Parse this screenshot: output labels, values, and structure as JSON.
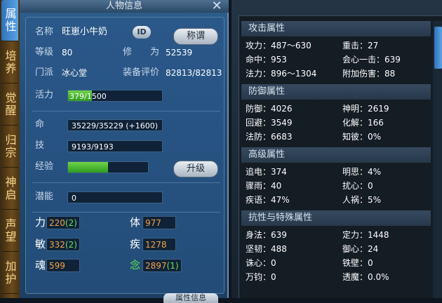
{
  "tabs": [
    "属性",
    "培养",
    "觉醒",
    "归宗",
    "神启",
    "声望",
    "加护"
  ],
  "window": {
    "title": "人物信息",
    "close": "✕"
  },
  "info": {
    "name_label": "名称",
    "name_value": "旺崽小牛奶",
    "id_button": "ID",
    "title_button": "称谓",
    "level_label": "等级",
    "level_value": "80",
    "cultivation_label": "修　　为",
    "cultivation_value": "52539",
    "sect_label": "门派",
    "sect_value": "冰心堂",
    "gear_label": "装备评价",
    "gear_value": "82813/82813",
    "vitality_label": "活力",
    "vitality_value": "379/1500",
    "vitality_fraction": 0.253
  },
  "stats": {
    "life_label": "命",
    "life_value": "35229/35229 (+1600)",
    "skill_label": "技",
    "skill_value": "9193/9193",
    "exp_label": "经验",
    "exp_fraction": 0.5,
    "upgrade_button": "升级",
    "potential_label": "潜能",
    "potential_value": "0"
  },
  "attributes": {
    "str_label": "力",
    "str_value": "220",
    "str_bonus": "(2)",
    "con_label": "体",
    "con_value": "977",
    "agi_label": "敏",
    "agi_value": "332",
    "agi_bonus": "(2)",
    "spd_label": "疾",
    "spd_value": "1278",
    "soul_label": "魂",
    "soul_value": "599",
    "mind_label": "念",
    "mind_value": "2897",
    "mind_bonus": "(1)"
  },
  "bottom_button": "属性信息",
  "right": {
    "attack_header": "攻击属性",
    "attack": [
      {
        "k": "攻力：",
        "v": "487～630"
      },
      {
        "k": "重击：",
        "v": "27"
      },
      {
        "k": "命中：",
        "v": "953"
      },
      {
        "k": "会心一击：",
        "v": "639"
      },
      {
        "k": "法力：",
        "v": "896～1304"
      },
      {
        "k": "附加伤害：",
        "v": "88"
      }
    ],
    "defense_header": "防御属性",
    "defense": [
      {
        "k": "防御：",
        "v": "4026"
      },
      {
        "k": "神明：",
        "v": "2619"
      },
      {
        "k": "回避：",
        "v": "3549"
      },
      {
        "k": "化解：",
        "v": "166"
      },
      {
        "k": "法防：",
        "v": "6683"
      },
      {
        "k": "知彼：",
        "v": "0%"
      }
    ],
    "advanced_header": "高级属性",
    "advanced": [
      {
        "k": "追电：",
        "v": "374"
      },
      {
        "k": "明思：",
        "v": "4%"
      },
      {
        "k": "骤雨：",
        "v": "40"
      },
      {
        "k": "扰心：",
        "v": "0"
      },
      {
        "k": "疾语：",
        "v": "47%"
      },
      {
        "k": "人祸：",
        "v": "5%"
      }
    ],
    "resist_header": "抗性与特殊属性",
    "resist": [
      {
        "k": "身法：",
        "v": "639"
      },
      {
        "k": "定力：",
        "v": "1448"
      },
      {
        "k": "坚韧：",
        "v": "488"
      },
      {
        "k": "御心：",
        "v": "24"
      },
      {
        "k": "诛心：",
        "v": "0"
      },
      {
        "k": "铁壁：",
        "v": "0"
      },
      {
        "k": "万钧：",
        "v": "0"
      },
      {
        "k": "透魔：",
        "v": "0.0%"
      }
    ]
  },
  "colors": {
    "accent": "#2f72b8",
    "bar_green": "#4cc22c",
    "number_orange": "#f4a24a",
    "number_green": "#6fe058"
  }
}
